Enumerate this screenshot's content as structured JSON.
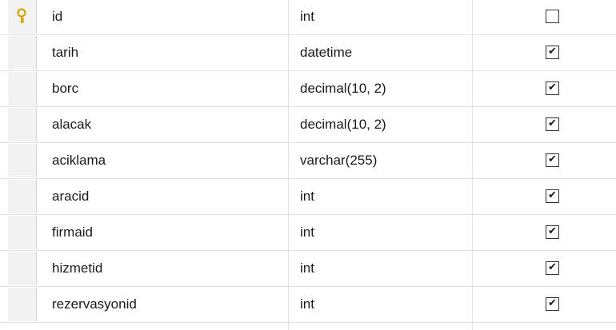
{
  "columns": [
    {
      "name": "id",
      "type": "int",
      "allow_nulls": false,
      "primary_key": true,
      "icon": "primary-key-icon"
    },
    {
      "name": "tarih",
      "type": "datetime",
      "allow_nulls": true
    },
    {
      "name": "borc",
      "type": "decimal(10, 2)",
      "allow_nulls": true
    },
    {
      "name": "alacak",
      "type": "decimal(10, 2)",
      "allow_nulls": true
    },
    {
      "name": "aciklama",
      "type": "varchar(255)",
      "allow_nulls": true
    },
    {
      "name": "aracid",
      "type": "int",
      "allow_nulls": true
    },
    {
      "name": "firmaid",
      "type": "int",
      "allow_nulls": true
    },
    {
      "name": "hizmetid",
      "type": "int",
      "allow_nulls": true
    },
    {
      "name": "rezervasyonid",
      "type": "int",
      "allow_nulls": true
    }
  ],
  "colors": {
    "key": "#d6a400",
    "grid_line": "#e2e2e2",
    "row_header": "#f2f2f2"
  }
}
